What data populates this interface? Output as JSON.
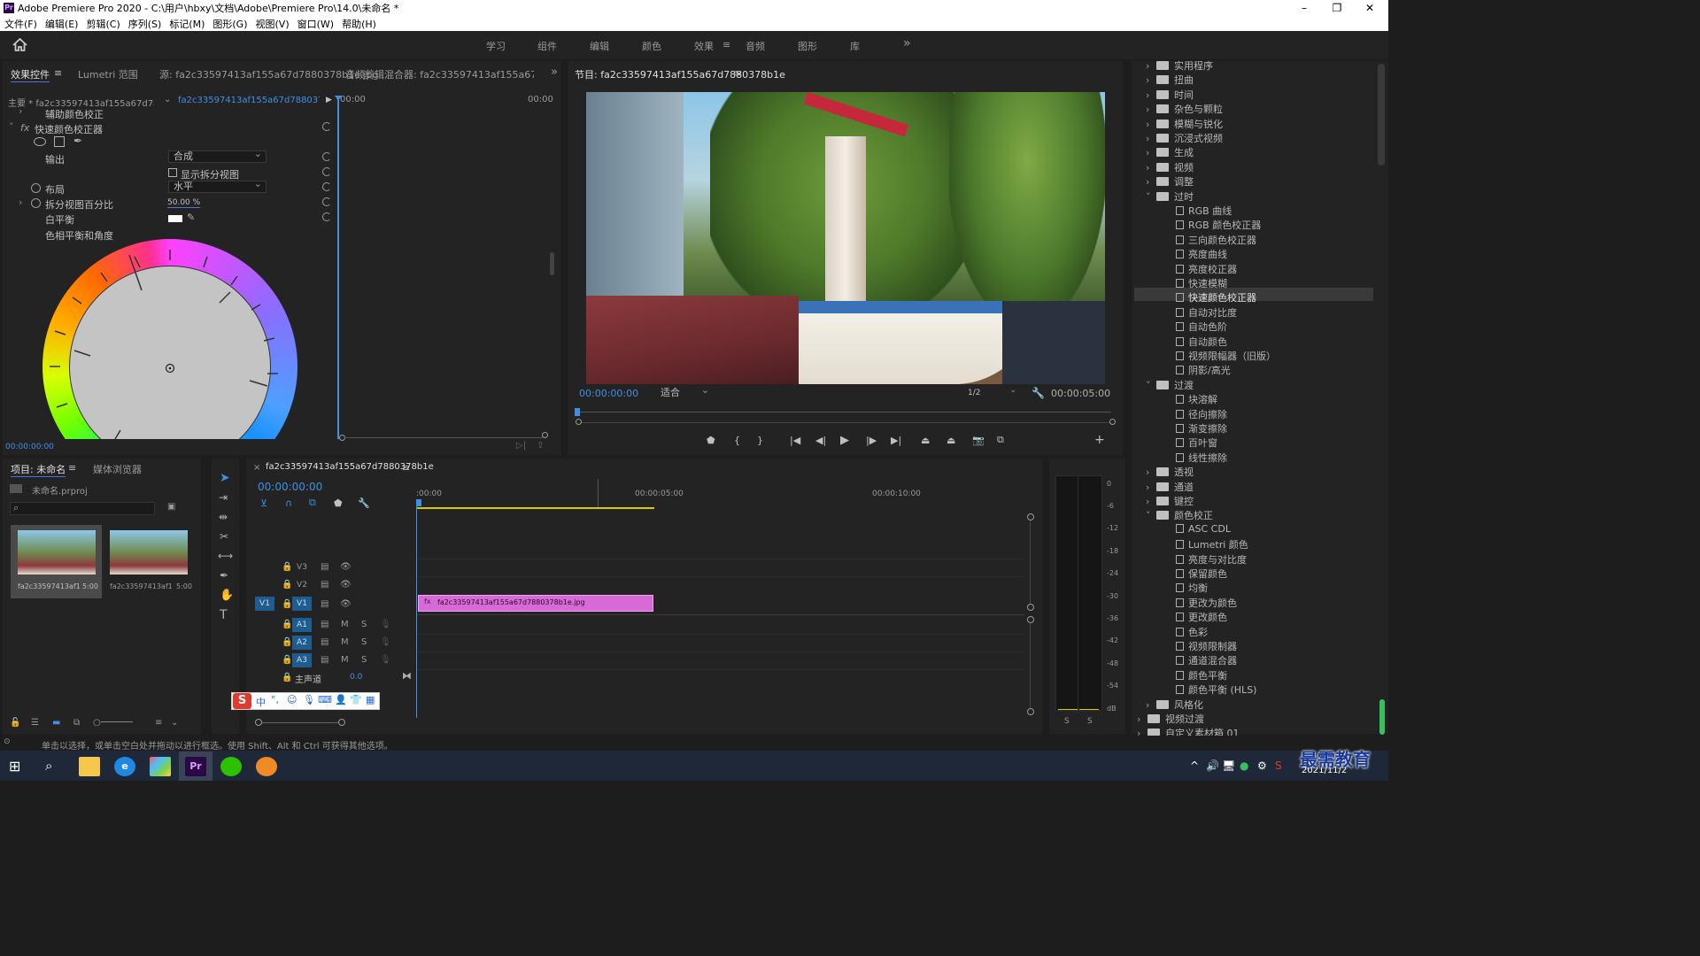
{
  "titlebar": {
    "title": "Adobe Premiere Pro 2020 - C:\\用户\\hbxy\\文档\\Adobe\\Premiere Pro\\14.0\\未命名 *"
  },
  "menubar": [
    "文件(F)",
    "编辑(E)",
    "剪辑(C)",
    "序列(S)",
    "标记(M)",
    "图形(G)",
    "视图(V)",
    "窗口(W)",
    "帮助(H)"
  ],
  "workspaces": [
    "学习",
    "组件",
    "编辑",
    "颜色",
    "效果",
    "音频",
    "图形",
    "库"
  ],
  "active_workspace": "效果",
  "effect_controls": {
    "tabs": [
      "效果控件",
      "Lumetri 范围",
      "源: fa2c33597413af155a67d7880378b1e.jpg",
      "音频剪辑混合器: fa2c33597413af155a67d788037"
    ],
    "master": "主要 * fa2c33597413af155a67d788037...",
    "clip": "fa2c33597413af155a67d7880378b1e ...",
    "time_start": "00:00",
    "time_end": "00:00",
    "aux_label": "辅助颜色校正",
    "effect_name": "快速颜色校正器",
    "output_label": "输出",
    "output_value": "合成",
    "split_label": "显示拆分视图",
    "layout_label": "布局",
    "layout_value": "水平",
    "split_pct_label": "拆分视图百分比",
    "split_pct_value": "50.00 %",
    "wb_label": "白平衡",
    "hue_label": "色相平衡和角度",
    "timecode": "00:00:00:00"
  },
  "program": {
    "title": "节目: fa2c33597413af155a67d7880378b1e",
    "timecode": "00:00:00:00",
    "fit": "适合",
    "quality": "1/2",
    "duration": "00:00:05:00"
  },
  "project": {
    "tabs": [
      "项目: 未命名",
      "媒体浏览器"
    ],
    "file": "未命名.prproj",
    "items": [
      {
        "name": "fa2c33597413af15...",
        "duration": "5:00"
      },
      {
        "name": "fa2c33597413af15...",
        "duration": "5:00"
      }
    ]
  },
  "timeline": {
    "tab": "fa2c33597413af155a67d7880378b1e",
    "timecode": "00:00:00:00",
    "ruler": [
      ":00:00",
      "00:00:05:00",
      "00:00:10:00"
    ],
    "tracks": [
      "V3",
      "V2",
      "V1",
      "A1",
      "A2",
      "A3"
    ],
    "source_patch": "V1",
    "master_label": "主声道",
    "master_value": "0.0",
    "clip_name": "fa2c33597413af155a67d7880378b1e.jpg"
  },
  "meter": {
    "scale": [
      "0",
      "-6",
      "-12",
      "-18",
      "-24",
      "-30",
      "-36",
      "-42",
      "-48",
      "-54",
      "dB"
    ],
    "solo": [
      "S",
      "S"
    ]
  },
  "effects": {
    "top_items": [
      "实用程序",
      "扭曲",
      "时间",
      "杂色与颗粒",
      "模糊与锐化",
      "沉浸式视频",
      "生成",
      "视频",
      "调整"
    ],
    "group1": "过时",
    "group1_items": [
      "RGB 曲线",
      "RGB 颜色校正器",
      "三向颜色校正器",
      "亮度曲线",
      "亮度校正器",
      "快速模糊",
      "快速颜色校正器",
      "自动对比度",
      "自动色阶",
      "自动颜色",
      "视频限幅器（旧版）",
      "阴影/高光"
    ],
    "group2": "过渡",
    "group2_items": [
      "块溶解",
      "径向擦除",
      "渐变擦除",
      "百叶窗",
      "线性擦除"
    ],
    "mid_items": [
      "透视",
      "通道",
      "键控"
    ],
    "group3": "颜色校正",
    "group3_items": [
      "ASC CDL",
      "Lumetri 颜色",
      "亮度与对比度",
      "保留颜色",
      "均衡",
      "更改为颜色",
      "更改颜色",
      "色彩",
      "视频限制器",
      "通道混合器",
      "颜色平衡",
      "颜色平衡 (HLS)"
    ],
    "tail_items": [
      "风格化"
    ],
    "root_items": [
      "视频过渡",
      "自定义素材箱 01"
    ],
    "selected": "快速颜色校正器"
  },
  "status": "单击以选择，或单击空白处并拖动以进行框选。使用 Shift、Alt 和 Ctrl 可获得其他选项。",
  "taskbar": {
    "date": "2021/11/2",
    "watermark": "最需教育"
  },
  "ime": {
    "logo": "S",
    "mode": "中"
  }
}
